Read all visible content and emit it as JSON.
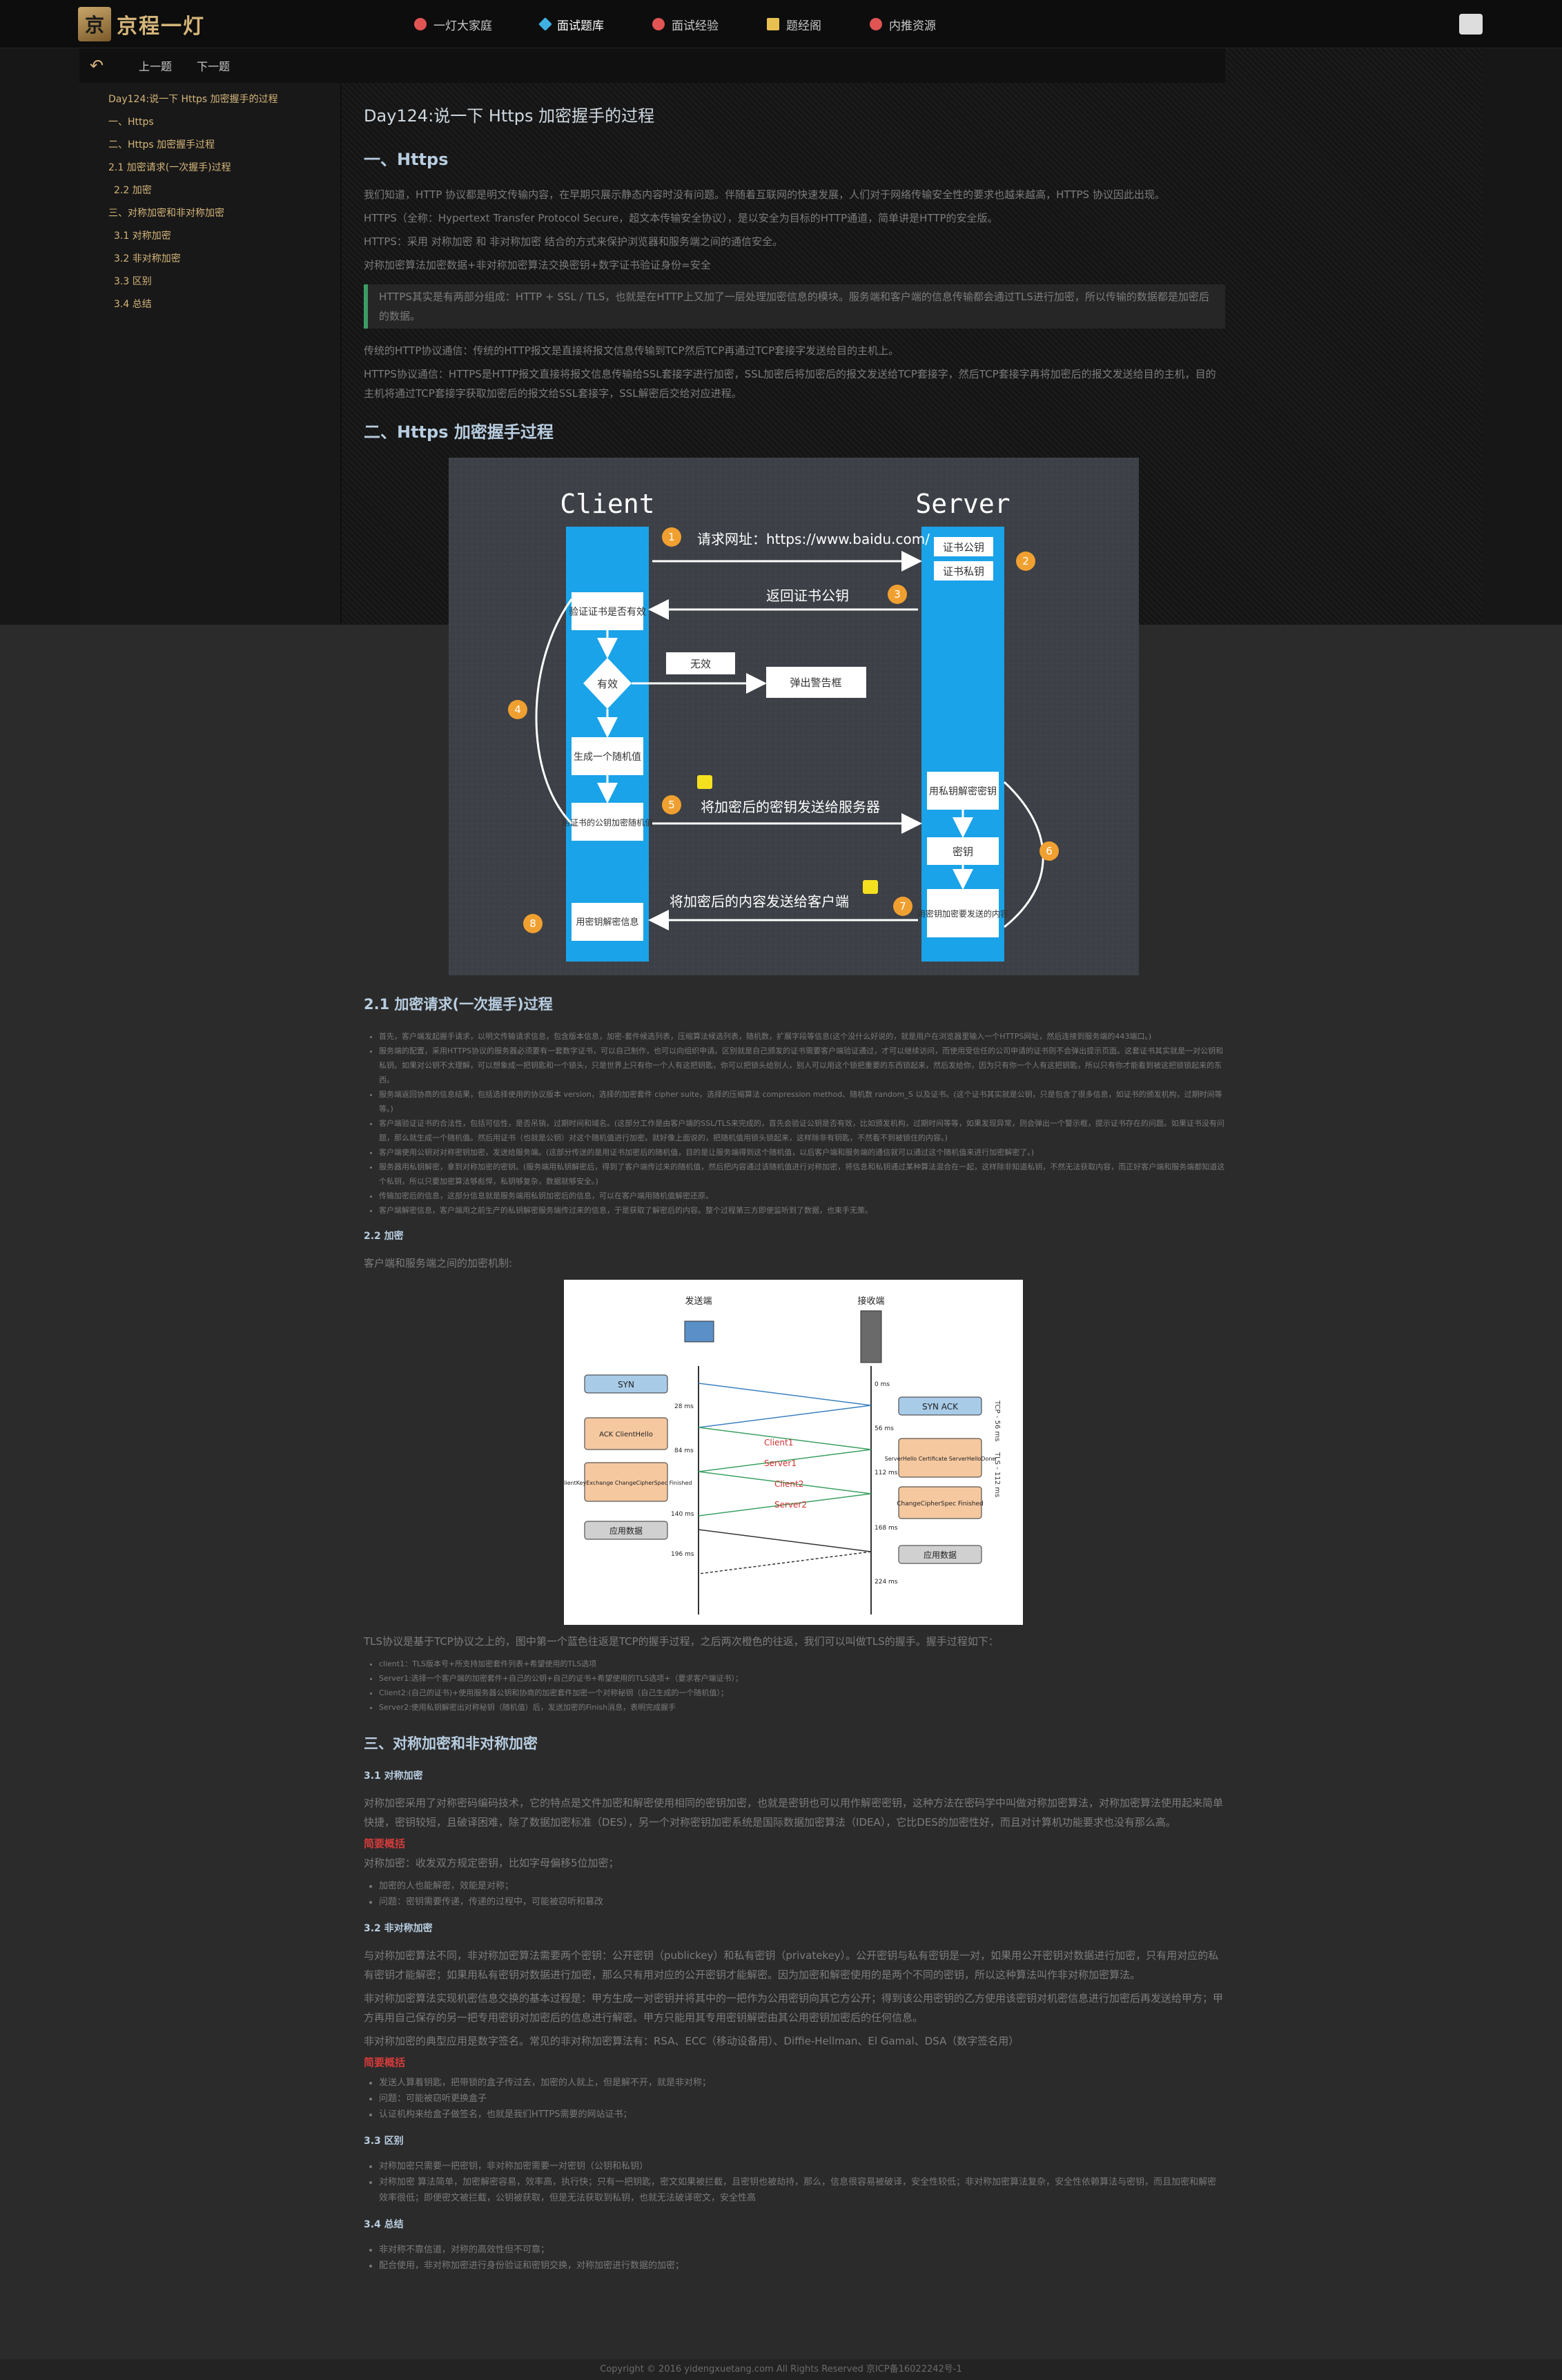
{
  "header": {
    "logo_char": "京",
    "logo_text": "京程一灯",
    "nav": [
      {
        "label": "一灯大家庭",
        "icon": "home-icon",
        "color": "#e05454"
      },
      {
        "label": "面试题库",
        "icon": "diamond-icon",
        "color": "#3fb0e0"
      },
      {
        "label": "面试经验",
        "icon": "shoe-icon",
        "color": "#e05454"
      },
      {
        "label": "题经阁",
        "icon": "book-icon",
        "color": "#e8c050"
      },
      {
        "label": "内推资源",
        "icon": "target-icon",
        "color": "#e05454"
      }
    ]
  },
  "toolbar": {
    "prev": "上一题",
    "next": "下一题"
  },
  "sidebar": {
    "items": [
      "Day124:说一下 Https 加密握手的过程",
      "一、Https",
      "二、Https 加密握手过程",
      "2.1 加密请求(一次握手)过程",
      "2.2 加密",
      "三、对称加密和非对称加密",
      "3.1 对称加密",
      "3.2 非对称加密",
      "3.3 区别",
      "3.4 总结"
    ]
  },
  "article": {
    "title": "Day124:说一下 Https 加密握手的过程",
    "s1_title": "一、Https",
    "s1_p1": "我们知道，HTTP 协议都是明文传输内容，在早期只展示静态内容时没有问题。伴随着互联网的快速发展，人们对于网络传输安全性的要求也越来越高，HTTPS 协议因此出现。",
    "s1_p2": "HTTPS（全称：Hypertext Transfer Protocol Secure，超文本传输安全协议），是以安全为目标的HTTP通道，简单讲是HTTP的安全版。",
    "s1_p3": "HTTPS：采用 对称加密 和 非对称加密 结合的方式来保护浏览器和服务端之间的通信安全。",
    "s1_p4": "对称加密算法加密数据+非对称加密算法交换密钥+数字证书验证身份=安全",
    "s1_quote": "HTTPS其实是有两部分组成：HTTP + SSL / TLS，也就是在HTTP上又加了一层处理加密信息的模块。服务端和客户端的信息传输都会通过TLS进行加密，所以传输的数据都是加密后的数据。",
    "s1_p5": "传统的HTTP协议通信：传统的HTTP报文是直接将报文信息传输到TCP然后TCP再通过TCP套接字发送给目的主机上。",
    "s1_p6": "HTTPS协议通信：HTTPS是HTTP报文直接将报文信息传输给SSL套接字进行加密，SSL加密后将加密后的报文发送给TCP套接字，然后TCP套接字再将加密后的报文发送给目的主机，目的主机将通过TCP套接字获取加密后的报文给SSL套接字，SSL解密后交给对应进程。",
    "s2_title": "二、Https 加密握手过程",
    "fig1": {
      "client": "Client",
      "server": "Server",
      "n1": "1",
      "n2": "2",
      "n3": "3",
      "n4": "4",
      "n5": "5",
      "n6": "6",
      "n7": "7",
      "n8": "8",
      "req": "请求网址：https://www.baidu.com/",
      "pub": "证书公钥",
      "priv": "证书私钥",
      "ret": "返回证书公钥",
      "verify": "验证证书是否有效",
      "valid": "有效",
      "invalid": "无效",
      "warn": "弹出警告框",
      "gen": "生成一个随机值",
      "encrypt": "用证书的公钥加密随机值",
      "send_key": "将加密后的密钥发送给服务器",
      "decrypt": "用私钥解密密钥",
      "key": "密钥",
      "enc_content": "用密钥加密要发送的内容",
      "send_content": "将加密后的内容发送给客户端",
      "dec_info": "用密钥解密信息"
    },
    "s21_title": "2.1 加密请求(一次握手)过程",
    "s21_list": [
      "首先，客户端发起握手请求，以明文传输请求信息，包含版本信息，加密-套件候选列表，压缩算法候选列表，随机数，扩展字段等信息(这个没什么好说的，就是用户在浏览器里输入一个HTTPS网址，然后连接到服务端的443端口。)",
      "服务端的配置，采用HTTPS协议的服务器必须要有一套数字证书，可以自己制作，也可以向组织申请。区别就是自己颁发的证书需要客户端验证通过，才可以继续访问，而使用受信任的公司申请的证书则不会弹出提示页面。这套证书其实就是一对公钥和私钥。如果对公钥不太理解，可以想象成一把钥匙和一个锁头，只是世界上只有你一个人有这把钥匙，你可以把锁头给别人，别人可以用这个锁把重要的东西锁起来，然后发给你，因为只有你一个人有这把钥匙，所以只有你才能看到被这把锁锁起来的东西。",
      "服务端返回协商的信息结果，包括选择使用的协议版本 version，选择的加密套件 cipher suite，选择的压缩算法 compression method、随机数 random_S 以及证书。(这个证书其实就是公钥，只是包含了很多信息，如证书的颁发机构，过期时间等等。)",
      "客户端验证证书的合法性，包括可信性，是否吊销，过期时间和域名。(这部分工作是由客户端的SSL/TLS来完成的，首先会验证公钥是否有效，比如颁发机构，过期时间等等，如果发现异常，则会弹出一个警示框，提示证书存在的问题。如果证书没有问题，那么就生成一个随机值。然后用证书（也就是公钥）对这个随机值进行加密。就好像上面说的，把随机值用锁头锁起来，这样除非有钥匙，不然看不到被锁住的内容。)",
      "客户端使用公钥对对称密钥加密，发送给服务端。(这部分传送的是用证书加密后的随机值，目的是让服务端得到这个随机值，以后客户端和服务端的通信就可以通过这个随机值来进行加密解密了。)",
      "服务器用私钥解密，拿到对称加密的密钥。(服务端用私钥解密后，得到了客户端传过来的随机值，然后把内容通过该随机值进行对称加密，将信息和私钥通过某种算法混合在一起，这样除非知道私钥，不然无法获取内容，而正好客户端和服务端都知道这个私钥，所以只要加密算法够彪悍，私钥够复杂，数据就够安全。)",
      "传输加密后的信息，这部分信息就是服务端用私钥加密后的信息，可以在客户端用随机值解密还原。",
      "客户端解密信息，客户端用之前生产的私钥解密服务端传过来的信息，于是获取了解密后的内容。整个过程第三方即使监听到了数据，也束手无策。"
    ],
    "s22_title": "2.2 加密",
    "s22_p": "客户端和服务端之间的加密机制:",
    "fig2": {
      "sender": "发送端",
      "receiver": "接收端",
      "syn": "SYN",
      "synack": "SYN ACK",
      "ack": "ACK ClientHello",
      "sh": "ServerHello Certificate ServerHelloDone",
      "cke": "ClientKeyExchange ChangeCipherSpec Finished",
      "ccs": "ChangeCipherSpec Finished",
      "app1": "应用数据",
      "app2": "应用数据",
      "c1": "Client1",
      "s1": "Server1",
      "c2": "Client2",
      "s2": "Server2",
      "t0": "0 ms",
      "t28": "28 ms",
      "t56": "56 ms",
      "t84": "84 ms",
      "t112": "112 ms",
      "t140": "140 ms",
      "t168": "168 ms",
      "t196": "196 ms",
      "t224": "224 ms",
      "tcp": "TCP - 56 ms",
      "tls": "TLS - 112 ms"
    },
    "s22_p2": "TLS协议是基于TCP协议之上的，图中第一个蓝色往返是TCP的握手过程，之后两次橙色的往返，我们可以叫做TLS的握手。握手过程如下：",
    "s22_list": [
      "client1：TLS版本号+所支持加密套件列表+希望使用的TLS选项",
      "Server1:选择一个客户端的加密套件+自己的公钥+自己的证书+希望使用的TLS选项+（要求客户端证书）；",
      "Client2:(自己的证书)+使用服务器公钥和协商的加密套件加密一个对称秘钥（自己生成的一个随机值）；",
      "Server2:使用私钥解密出对称秘钥（随机值）后，发送加密的Finish消息，表明完成握手"
    ],
    "s3_title": "三、对称加密和非对称加密",
    "s31_title": "3.1 对称加密",
    "s31_p": "对称加密采用了对称密码编码技术，它的特点是文件加密和解密使用相同的密钥加密，也就是密钥也可以用作解密密钥，这种方法在密码学中叫做对称加密算法，对称加密算法使用起来简单快捷，密钥较短，且破译困难，除了数据加密标准（DES），另一个对称密钥加密系统是国际数据加密算法（IDEA），它比DES的加密性好，而且对计算机功能要求也没有那么高。",
    "s31_red": "简要概括",
    "s31_p2": "对称加密：收发双方规定密钥，比如字母偏移5位加密；",
    "s31_list": [
      "加密的人也能解密，效能是对称；",
      "问题：密钥需要传递，传递的过程中，可能被窃听和篡改"
    ],
    "s32_title": "3.2 非对称加密",
    "s32_p1": "与对称加密算法不同，非对称加密算法需要两个密钥：公开密钥（publickey）和私有密钥（privatekey）。公开密钥与私有密钥是一对，如果用公开密钥对数据进行加密，只有用对应的私有密钥才能解密；如果用私有密钥对数据进行加密，那么只有用对应的公开密钥才能解密。因为加密和解密使用的是两个不同的密钥，所以这种算法叫作非对称加密算法。",
    "s32_p2": "非对称加密算法实现机密信息交换的基本过程是：甲方生成一对密钥并将其中的一把作为公用密钥向其它方公开；得到该公用密钥的乙方使用该密钥对机密信息进行加密后再发送给甲方；甲方再用自己保存的另一把专用密钥对加密后的信息进行解密。甲方只能用其专用密钥解密由其公用密钥加密后的任何信息。",
    "s32_p3": "非对称加密的典型应用是数字签名。常见的非对称加密算法有：RSA、ECC（移动设备用）、Diffie-Hellman、El Gamal、DSA（数字签名用）",
    "s32_red": "简要概括",
    "s32_list": [
      "发送人算着钥匙，把带锁的盒子传过去，加密的人就上，但是解不开，就是非对称；",
      "问题：可能被窃听更换盒子",
      "认证机构来给盒子做签名，也就是我们HTTPS需要的网站证书；"
    ],
    "s33_title": "3.3 区别",
    "s33_list": [
      "对称加密只需要一把密钥，非对称加密需要一对密钥（公钥和私钥）",
      "对称加密 算法简单，加密解密容易，效率高，执行快；只有一把钥匙，密文如果被拦截，且密钥也被劫持，那么，信息很容易被破译，安全性较低；非对称加密算法复杂，安全性依赖算法与密钥，而且加密和解密效率很低；即便密文被拦截，公钥被获取，但是无法获取到私钥，也就无法破译密文，安全性高"
    ],
    "s34_title": "3.4 总结",
    "s34_list": [
      "非对称不靠信道，对称的高效性但不可靠；",
      "配合使用，非对称加密进行身份验证和密钥交换，对称加密进行数据的加密；"
    ]
  },
  "footer": "Copyright © 2016 yidengxuetang.com All Rights Reserved 京ICP备16022242号-1"
}
